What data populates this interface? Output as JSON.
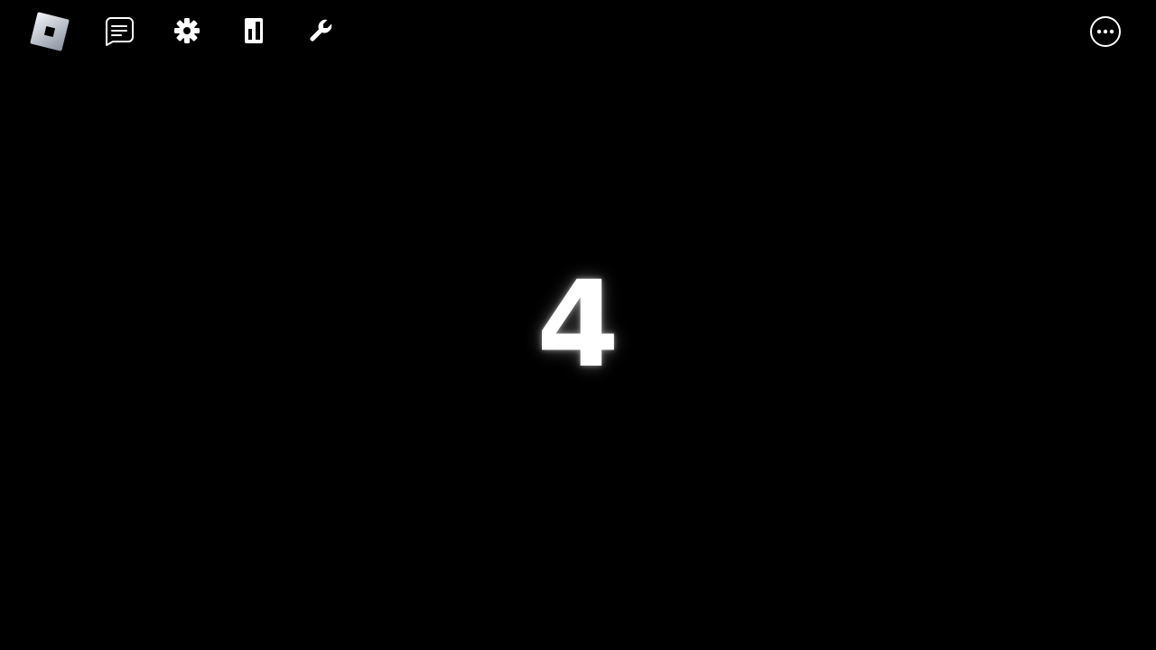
{
  "topbar": {
    "menu_button": {
      "icon": "roblox-logo-icon"
    },
    "chat_button": {
      "icon": "chat-icon"
    },
    "settings_button": {
      "icon": "gear-icon"
    },
    "backpack_button": {
      "icon": "backpack-icon"
    },
    "tools_button": {
      "icon": "wrench-icon"
    },
    "more_button": {
      "icon": "more-options-icon"
    }
  },
  "game": {
    "countdown_value": "4"
  },
  "colors": {
    "background": "#000000",
    "icon": "#ffffff",
    "logo_gradient_light": "#e8ecf2",
    "logo_gradient_dark": "#8a93a0",
    "countdown_text": "#ffffff"
  }
}
